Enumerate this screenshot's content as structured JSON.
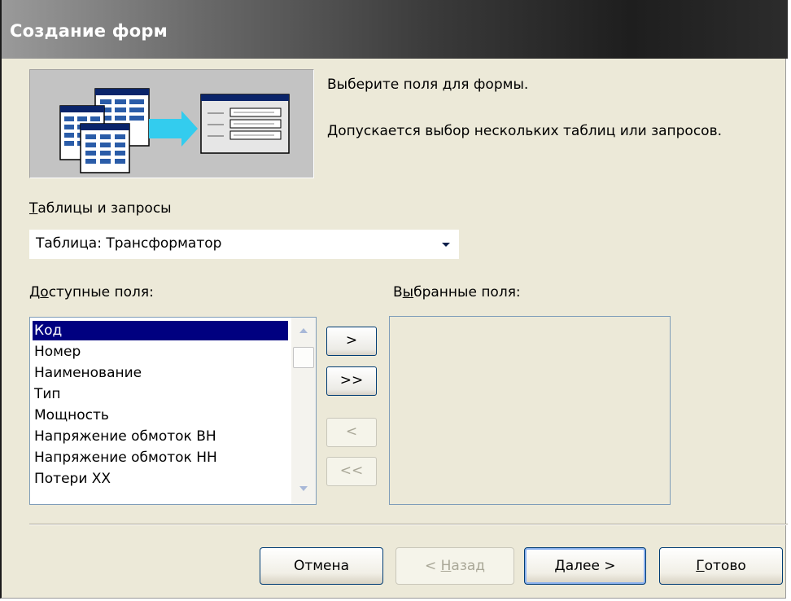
{
  "window": {
    "title": "Создание форм"
  },
  "intro": {
    "line1": "Выберите поля для формы.",
    "line2": "Допускается выбор нескольких таблиц или запросов."
  },
  "tables_label": {
    "accel": "Т",
    "rest": "аблицы и запросы"
  },
  "tables_combo": {
    "value": "Таблица: Трансформатор"
  },
  "available": {
    "label_before": "Д",
    "accel": "о",
    "label_after": "ступные поля:",
    "items": [
      "Код",
      "Номер",
      "Наименование",
      "Тип",
      "Мощность",
      "Напряжение обмоток ВН",
      "Напряжение обмоток НН",
      "Потери ХХ"
    ],
    "selected_index": 0
  },
  "selected_fields": {
    "label_before": "В",
    "accel": "ы",
    "label_after": "бранные поля:",
    "items": []
  },
  "transfer": {
    "add_one": ">",
    "add_all": ">>",
    "remove_one": "<",
    "remove_all": "<<"
  },
  "buttons": {
    "cancel": "Отмена",
    "back_prefix": "< ",
    "back_accel": "Н",
    "back_rest": "азад",
    "next_accel": "Д",
    "next_rest": "алее >",
    "finish_accel": "Г",
    "finish_rest": "отово"
  },
  "colors": {
    "selection": "#000080",
    "dialog_bg": "#ece9d8",
    "arrow": "#33ccee"
  }
}
